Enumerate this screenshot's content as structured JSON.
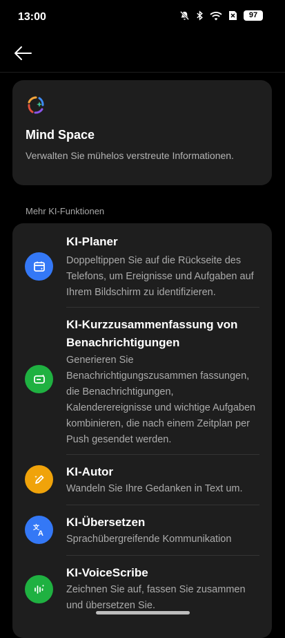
{
  "status_bar": {
    "time": "13:00",
    "icons": [
      "bell-off-icon",
      "bluetooth-icon",
      "wifi-icon",
      "sim-icon"
    ],
    "battery": "97"
  },
  "app_bar": {
    "back_icon": "arrow-left-icon"
  },
  "mind_space": {
    "title": "Mind Space",
    "description": "Verwalten Sie mühelos verstreute Informationen.",
    "icon": "mind-space-logo-icon"
  },
  "section_label": "Mehr KI-Funktionen",
  "features": [
    {
      "title": "KI-Planer",
      "description": "Doppeltippen Sie auf die Rückseite des Telefons, um Ereignisse und Aufgaben auf Ihrem Bildschirm zu identifizieren.",
      "icon": "calendar-icon",
      "color": "#3478f6"
    },
    {
      "title": "KI-Kurzzusammenfassung von Benachrichtigungen",
      "description": "Generieren Sie Benachrichtigungszusammen fassungen, die Benachrichtigungen, Kalenderereignisse und wichtige Aufgaben kombinieren, die nach einem Zeitplan per Push gesendet werden.",
      "icon": "notification-summary-icon",
      "color": "#1fb141"
    },
    {
      "title": "KI-Autor",
      "description": "Wandeln Sie Ihre Gedanken in Text um.",
      "icon": "pen-sparkle-icon",
      "color": "#f0a30a"
    },
    {
      "title": "KI-Übersetzen",
      "description": "Sprachübergreifende Kommunikation",
      "icon": "translate-icon",
      "color": "#3478f6"
    },
    {
      "title": "KI-VoiceScribe",
      "description": "Zeichnen Sie auf, fassen Sie zusammen und übersetzen Sie.",
      "icon": "voice-wave-icon",
      "color": "#1fb141"
    }
  ]
}
